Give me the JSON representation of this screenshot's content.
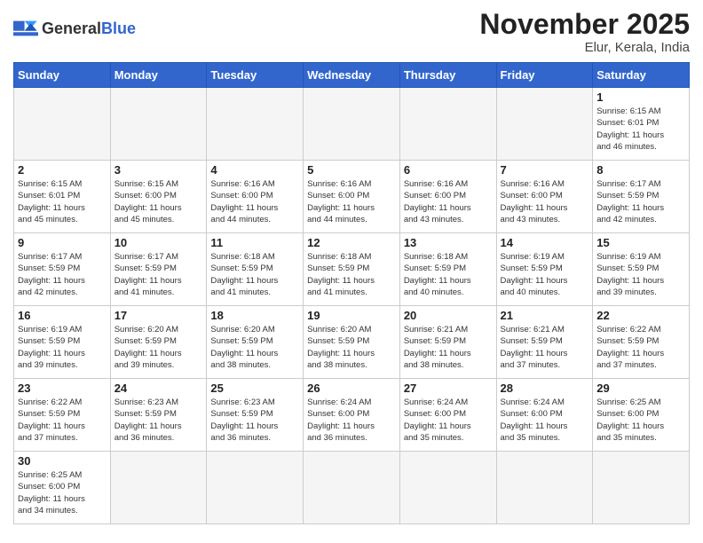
{
  "header": {
    "logo": {
      "general": "General",
      "blue": "Blue"
    },
    "title": "November 2025",
    "location": "Elur, Kerala, India"
  },
  "weekdays": [
    "Sunday",
    "Monday",
    "Tuesday",
    "Wednesday",
    "Thursday",
    "Friday",
    "Saturday"
  ],
  "weeks": [
    [
      {
        "day": null,
        "info": null
      },
      {
        "day": null,
        "info": null
      },
      {
        "day": null,
        "info": null
      },
      {
        "day": null,
        "info": null
      },
      {
        "day": null,
        "info": null
      },
      {
        "day": null,
        "info": null
      },
      {
        "day": "1",
        "info": "Sunrise: 6:15 AM\nSunset: 6:01 PM\nDaylight: 11 hours\nand 46 minutes."
      }
    ],
    [
      {
        "day": "2",
        "info": "Sunrise: 6:15 AM\nSunset: 6:01 PM\nDaylight: 11 hours\nand 45 minutes."
      },
      {
        "day": "3",
        "info": "Sunrise: 6:15 AM\nSunset: 6:00 PM\nDaylight: 11 hours\nand 45 minutes."
      },
      {
        "day": "4",
        "info": "Sunrise: 6:16 AM\nSunset: 6:00 PM\nDaylight: 11 hours\nand 44 minutes."
      },
      {
        "day": "5",
        "info": "Sunrise: 6:16 AM\nSunset: 6:00 PM\nDaylight: 11 hours\nand 44 minutes."
      },
      {
        "day": "6",
        "info": "Sunrise: 6:16 AM\nSunset: 6:00 PM\nDaylight: 11 hours\nand 43 minutes."
      },
      {
        "day": "7",
        "info": "Sunrise: 6:16 AM\nSunset: 6:00 PM\nDaylight: 11 hours\nand 43 minutes."
      },
      {
        "day": "8",
        "info": "Sunrise: 6:17 AM\nSunset: 5:59 PM\nDaylight: 11 hours\nand 42 minutes."
      }
    ],
    [
      {
        "day": "9",
        "info": "Sunrise: 6:17 AM\nSunset: 5:59 PM\nDaylight: 11 hours\nand 42 minutes."
      },
      {
        "day": "10",
        "info": "Sunrise: 6:17 AM\nSunset: 5:59 PM\nDaylight: 11 hours\nand 41 minutes."
      },
      {
        "day": "11",
        "info": "Sunrise: 6:18 AM\nSunset: 5:59 PM\nDaylight: 11 hours\nand 41 minutes."
      },
      {
        "day": "12",
        "info": "Sunrise: 6:18 AM\nSunset: 5:59 PM\nDaylight: 11 hours\nand 41 minutes."
      },
      {
        "day": "13",
        "info": "Sunrise: 6:18 AM\nSunset: 5:59 PM\nDaylight: 11 hours\nand 40 minutes."
      },
      {
        "day": "14",
        "info": "Sunrise: 6:19 AM\nSunset: 5:59 PM\nDaylight: 11 hours\nand 40 minutes."
      },
      {
        "day": "15",
        "info": "Sunrise: 6:19 AM\nSunset: 5:59 PM\nDaylight: 11 hours\nand 39 minutes."
      }
    ],
    [
      {
        "day": "16",
        "info": "Sunrise: 6:19 AM\nSunset: 5:59 PM\nDaylight: 11 hours\nand 39 minutes."
      },
      {
        "day": "17",
        "info": "Sunrise: 6:20 AM\nSunset: 5:59 PM\nDaylight: 11 hours\nand 39 minutes."
      },
      {
        "day": "18",
        "info": "Sunrise: 6:20 AM\nSunset: 5:59 PM\nDaylight: 11 hours\nand 38 minutes."
      },
      {
        "day": "19",
        "info": "Sunrise: 6:20 AM\nSunset: 5:59 PM\nDaylight: 11 hours\nand 38 minutes."
      },
      {
        "day": "20",
        "info": "Sunrise: 6:21 AM\nSunset: 5:59 PM\nDaylight: 11 hours\nand 38 minutes."
      },
      {
        "day": "21",
        "info": "Sunrise: 6:21 AM\nSunset: 5:59 PM\nDaylight: 11 hours\nand 37 minutes."
      },
      {
        "day": "22",
        "info": "Sunrise: 6:22 AM\nSunset: 5:59 PM\nDaylight: 11 hours\nand 37 minutes."
      }
    ],
    [
      {
        "day": "23",
        "info": "Sunrise: 6:22 AM\nSunset: 5:59 PM\nDaylight: 11 hours\nand 37 minutes."
      },
      {
        "day": "24",
        "info": "Sunrise: 6:23 AM\nSunset: 5:59 PM\nDaylight: 11 hours\nand 36 minutes."
      },
      {
        "day": "25",
        "info": "Sunrise: 6:23 AM\nSunset: 5:59 PM\nDaylight: 11 hours\nand 36 minutes."
      },
      {
        "day": "26",
        "info": "Sunrise: 6:24 AM\nSunset: 6:00 PM\nDaylight: 11 hours\nand 36 minutes."
      },
      {
        "day": "27",
        "info": "Sunrise: 6:24 AM\nSunset: 6:00 PM\nDaylight: 11 hours\nand 35 minutes."
      },
      {
        "day": "28",
        "info": "Sunrise: 6:24 AM\nSunset: 6:00 PM\nDaylight: 11 hours\nand 35 minutes."
      },
      {
        "day": "29",
        "info": "Sunrise: 6:25 AM\nSunset: 6:00 PM\nDaylight: 11 hours\nand 35 minutes."
      }
    ],
    [
      {
        "day": "30",
        "info": "Sunrise: 6:25 AM\nSunset: 6:00 PM\nDaylight: 11 hours\nand 34 minutes."
      },
      {
        "day": null,
        "info": null
      },
      {
        "day": null,
        "info": null
      },
      {
        "day": null,
        "info": null
      },
      {
        "day": null,
        "info": null
      },
      {
        "day": null,
        "info": null
      },
      {
        "day": null,
        "info": null
      }
    ]
  ]
}
